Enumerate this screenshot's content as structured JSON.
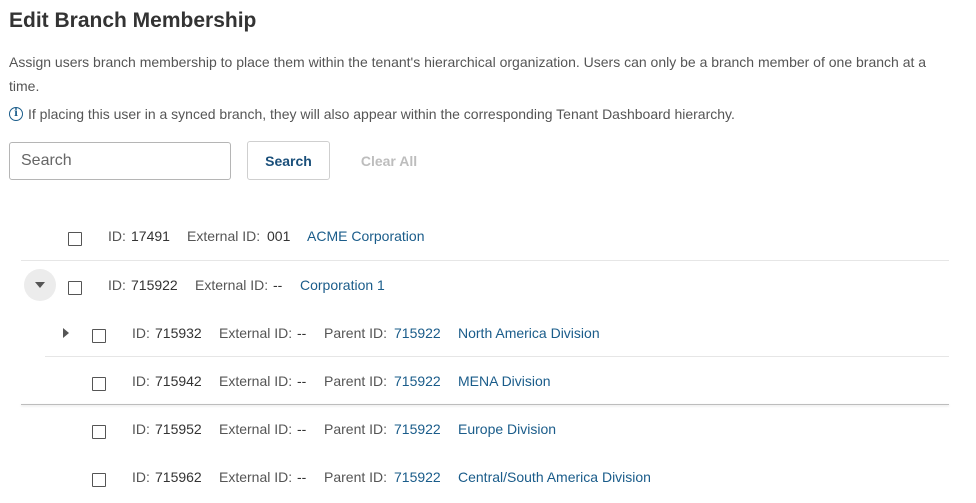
{
  "page": {
    "title": "Edit Branch Membership",
    "description": "Assign users branch membership to place them within the tenant's hierarchical organization. Users can only be a branch member of one branch at a time.",
    "info_note": "If placing this user in a synced branch, they will also appear within the corresponding Tenant Dashboard hierarchy.",
    "info_icon": "info-icon"
  },
  "search": {
    "placeholder": "Search",
    "value": "",
    "search_label": "Search",
    "clear_label": "Clear All"
  },
  "labels": {
    "id": "ID:",
    "external_id": "External ID:",
    "parent_id": "Parent ID:"
  },
  "branches": [
    {
      "id": "17491",
      "external_id": "001",
      "name": "ACME Corporation"
    },
    {
      "id": "715922",
      "external_id": "--",
      "name": "Corporation 1",
      "expanded": true
    },
    {
      "id": "715932",
      "external_id": "--",
      "parent_id": "715922",
      "name": "North America Division",
      "has_children": true
    },
    {
      "id": "715942",
      "external_id": "--",
      "parent_id": "715922",
      "name": "MENA Division"
    },
    {
      "id": "715952",
      "external_id": "--",
      "parent_id": "715922",
      "name": "Europe Division"
    },
    {
      "id": "715962",
      "external_id": "--",
      "parent_id": "715922",
      "name": "Central/South America Division"
    }
  ]
}
